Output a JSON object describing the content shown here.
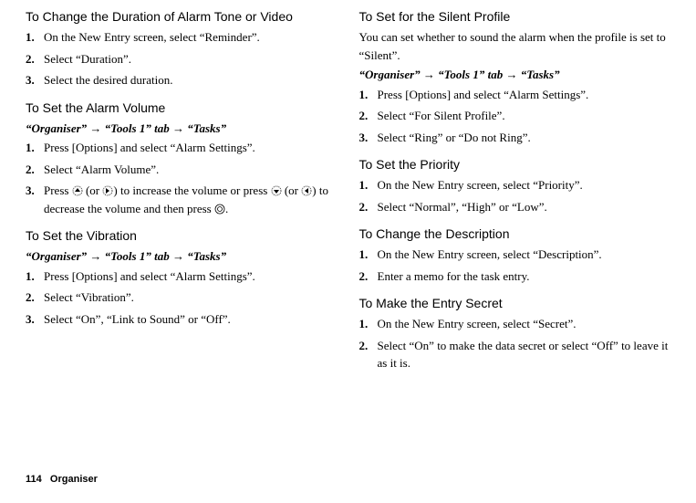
{
  "left": {
    "s1": {
      "title": "To Change the Duration of Alarm Tone or Video",
      "steps": [
        "On the New Entry screen, select “Reminder”.",
        "Select “Duration”.",
        "Select the desired duration."
      ]
    },
    "s2": {
      "title": "To Set the Alarm Volume",
      "breadcrumb": "“Organiser” → “Tools 1” tab → “Tasks”",
      "steps": [
        "Press [Options] and select “Alarm Settings”.",
        "Select “Alarm Volume”."
      ],
      "step3_prefix": "Press ",
      "step3_mid1": " (or ",
      "step3_mid2": ") to increase the volume or press ",
      "step3_mid3": " (or ",
      "step3_mid4": ") to decrease the volume and then press ",
      "step3_end": "."
    },
    "s3": {
      "title": "To Set the Vibration",
      "breadcrumb": "“Organiser” → “Tools 1” tab → “Tasks”",
      "steps": [
        "Press [Options] and select “Alarm Settings”.",
        "Select “Vibration”.",
        "Select “On”, “Link to Sound” or “Off”."
      ]
    }
  },
  "right": {
    "s1": {
      "title": "To Set for the Silent Profile",
      "intro": "You can set whether to sound the alarm when the profile is set to “Silent”.",
      "breadcrumb": "“Organiser” → “Tools 1” tab → “Tasks”",
      "steps": [
        "Press [Options] and select “Alarm Settings”.",
        "Select “For Silent Profile”.",
        "Select “Ring” or “Do not Ring”."
      ]
    },
    "s2": {
      "title": "To Set the Priority",
      "steps": [
        "On the New Entry screen, select “Priority”.",
        "Select “Normal”, “High” or “Low”."
      ]
    },
    "s3": {
      "title": "To Change the Description",
      "steps": [
        "On the New Entry screen, select “Description”.",
        "Enter a memo for the task entry."
      ]
    },
    "s4": {
      "title": "To Make the Entry Secret",
      "steps": [
        "On the New Entry screen, select “Secret”.",
        "Select “On” to make the data secret or select “Off” to leave it as it is."
      ]
    }
  },
  "footer": {
    "page": "114",
    "chapter": "Organiser"
  }
}
